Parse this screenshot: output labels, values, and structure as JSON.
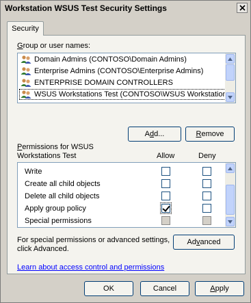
{
  "window": {
    "title": "Workstation WSUS Test Security Settings"
  },
  "tab": {
    "label": "Security"
  },
  "groups": {
    "label_prefix": "",
    "label_underlined": "G",
    "label_rest": "roup or user names:",
    "items": [
      {
        "label": "Domain Admins (CONTOSO\\Domain Admins)",
        "icon": "users-icon",
        "selected": false
      },
      {
        "label": "Enterprise Admins (CONTOSO\\Enterprise Admins)",
        "icon": "users-icon",
        "selected": false
      },
      {
        "label": "ENTERPRISE DOMAIN CONTROLLERS",
        "icon": "users-icon",
        "selected": false
      },
      {
        "label": "WSUS Workstations Test (CONTOSO\\WSUS Workstation",
        "icon": "users-icon",
        "selected": true
      }
    ]
  },
  "buttons": {
    "add_pre": "A",
    "add_ul": "d",
    "add_post": "d...",
    "remove_ul": "R",
    "remove_post": "emove",
    "advanced_pre": "Ad",
    "advanced_ul": "v",
    "advanced_post": "anced",
    "ok": "OK",
    "cancel": "Cancel",
    "apply_ul": "A",
    "apply_post": "pply"
  },
  "permissions": {
    "label_ul": "P",
    "label_line1_rest": "ermissions for WSUS",
    "label_line2": "Workstations Test",
    "allow_header": "Allow",
    "deny_header": "Deny",
    "rows": [
      {
        "name": "Write",
        "allow": false,
        "deny": false,
        "disabled": false
      },
      {
        "name": "Create all child objects",
        "allow": false,
        "deny": false,
        "disabled": false
      },
      {
        "name": "Delete all child objects",
        "allow": false,
        "deny": false,
        "disabled": false
      },
      {
        "name": "Apply group policy",
        "allow": true,
        "deny": false,
        "disabled": false
      },
      {
        "name": "Special permissions",
        "allow": false,
        "deny": false,
        "disabled": true
      }
    ]
  },
  "advanced_info": {
    "line1": "For special permissions or advanced settings,",
    "line2": "click Advanced."
  },
  "help_link": "Learn about access control and permissions"
}
